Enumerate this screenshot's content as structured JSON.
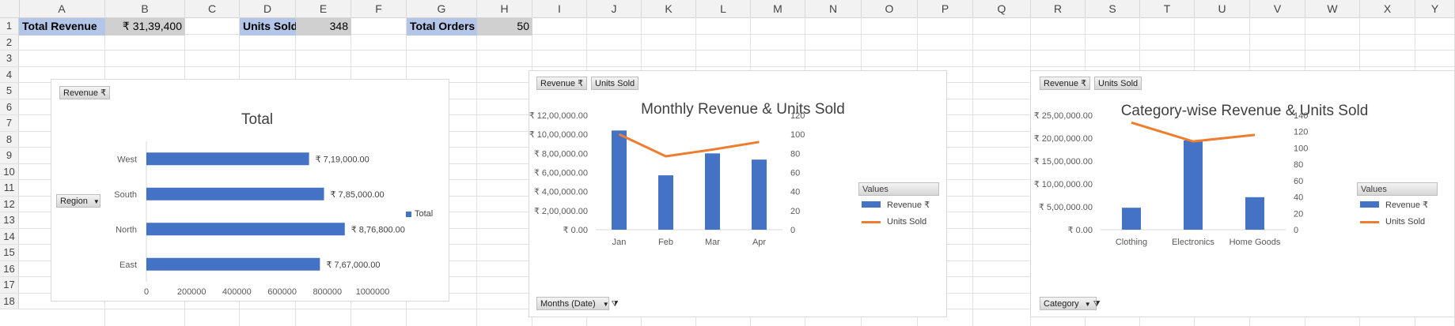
{
  "columns": [
    "A",
    "B",
    "C",
    "D",
    "E",
    "F",
    "G",
    "H",
    "I",
    "J",
    "K",
    "L",
    "M",
    "N",
    "O",
    "P",
    "Q",
    "R",
    "S",
    "T",
    "U",
    "V",
    "W",
    "X",
    "Y"
  ],
  "rows": [
    "1",
    "2",
    "3",
    "4",
    "5",
    "6",
    "7",
    "8",
    "9",
    "10",
    "11",
    "12",
    "13",
    "14",
    "15",
    "16",
    "17",
    "18"
  ],
  "kpis": {
    "revenue_label": "Total Revenue",
    "revenue_value": "₹ 31,39,400",
    "units_label": "Units Sold",
    "units_value": "348",
    "orders_label": "Total Orders",
    "orders_value": "50"
  },
  "colors": {
    "bar": "#4472c4",
    "line": "#ed7d31",
    "label_fill": "#b4c6e7",
    "gray_fill": "#d0d0d0"
  },
  "chart1": {
    "field_button": "Revenue ₹",
    "row_button": "Region",
    "legend_label": "Total",
    "chart_data": {
      "type": "bar",
      "orientation": "horizontal",
      "title": "Total",
      "categories": [
        "West",
        "South",
        "North",
        "East"
      ],
      "values": [
        719000,
        785000,
        876800,
        767000
      ],
      "data_labels": [
        "₹ 7,19,000.00",
        "₹ 7,85,000.00",
        "₹ 8,76,800.00",
        "₹ 7,67,000.00"
      ],
      "x_ticks": [
        "0",
        "200000",
        "400000",
        "600000",
        "800000",
        "1000000"
      ],
      "xlim": [
        0,
        1000000
      ]
    }
  },
  "chart2": {
    "field_buttons": [
      "Revenue ₹",
      "Units Sold"
    ],
    "axis_button": "Months (Date)",
    "legend_title": "Values",
    "legend": [
      "Revenue ₹",
      "Units Sold"
    ],
    "chart_data": {
      "type": "bar",
      "title": "Monthly Revenue & Units Sold",
      "categories": [
        "Jan",
        "Feb",
        "Mar",
        "Apr"
      ],
      "series": [
        {
          "name": "Revenue ₹",
          "type": "bar",
          "axis": "left",
          "values": [
            1040000,
            570000,
            800000,
            735000
          ]
        },
        {
          "name": "Units Sold",
          "type": "line",
          "axis": "right",
          "values": [
            100,
            77,
            84,
            92
          ]
        }
      ],
      "y_ticks": [
        "₹ 0.00",
        "₹ 2,00,000.00",
        "₹ 4,00,000.00",
        "₹ 6,00,000.00",
        "₹ 8,00,000.00",
        "₹ 10,00,000.00",
        "₹ 12,00,000.00"
      ],
      "ylim": [
        0,
        1200000
      ],
      "y2_ticks": [
        "0",
        "20",
        "40",
        "60",
        "80",
        "100",
        "120"
      ],
      "y2lim": [
        0,
        120
      ]
    }
  },
  "chart3": {
    "field_buttons": [
      "Revenue ₹",
      "Units Sold"
    ],
    "axis_button": "Category",
    "legend_title": "Values",
    "legend": [
      "Revenue ₹",
      "Units Sold"
    ],
    "chart_data": {
      "type": "bar",
      "title": "Category-wise Revenue & Units Sold",
      "categories": [
        "Clothing",
        "Electronics",
        "Home Goods"
      ],
      "series": [
        {
          "name": "Revenue ₹",
          "type": "bar",
          "axis": "left",
          "values": [
            480000,
            1950000,
            710000
          ]
        },
        {
          "name": "Units Sold",
          "type": "line",
          "axis": "right",
          "values": [
            131,
            108,
            116
          ]
        }
      ],
      "y_ticks": [
        "₹ 0.00",
        "₹ 5,00,000.00",
        "₹ 10,00,000.00",
        "₹ 15,00,000.00",
        "₹ 20,00,000.00",
        "₹ 25,00,000.00"
      ],
      "ylim": [
        0,
        2500000
      ],
      "y2_ticks": [
        "0",
        "20",
        "40",
        "60",
        "80",
        "100",
        "120",
        "140"
      ],
      "y2lim": [
        0,
        140
      ]
    }
  }
}
